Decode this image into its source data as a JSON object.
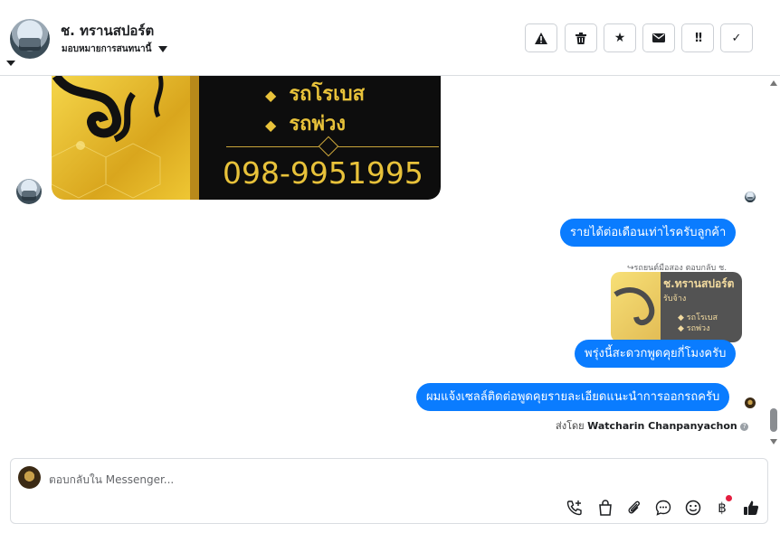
{
  "header": {
    "page_name": "ช. ทรานสปอร์ต",
    "assign_label": "มอบหมายการสนทนานี้",
    "toolbar": [
      {
        "icon": "warning-icon",
        "glyph": "⚠"
      },
      {
        "icon": "trash-icon",
        "glyph": "🗑"
      },
      {
        "icon": "star-icon",
        "glyph": "★"
      },
      {
        "icon": "mail-icon",
        "glyph": "✉"
      },
      {
        "icon": "priority-icon",
        "glyph": "!!"
      },
      {
        "icon": "check-icon",
        "glyph": "✓"
      }
    ]
  },
  "banner": {
    "line1": "รถโรเบส",
    "line2": "รถพ่วง",
    "phone": "098-9951995"
  },
  "messages": {
    "m1": "รายได้ต่อเดือนเท่าไรครับลูกค้า",
    "reply_header": "รถยนต์มือสอง ตอบกลับ ช.",
    "thumb_title": "ช.ทรานสปอร์ต",
    "thumb_sub": "รับจ้าง",
    "thumb_l1": "รถโรเบส",
    "thumb_l2": "รถพ่วง",
    "m2": "พรุ่งนี้สะดวกพูดคุยกี่โมงครับ",
    "m3": "ผมแจ้งเซลล์ติดต่อพูดคุยรายละเอียดแนะนำการออกรถครับ",
    "sent_by_label": "ส่งโดย",
    "sent_by_name": "Watcharin Chanpanyachon"
  },
  "composer": {
    "placeholder": "ตอบกลับใน Messenger...",
    "icons": [
      "call-add-icon",
      "bag-icon",
      "attach-icon",
      "chat-icon",
      "emoji-icon",
      "baht-icon",
      "like-icon"
    ]
  },
  "colors": {
    "accent": "#0a7cff",
    "gold": "#e8c23a",
    "dark": "#0d0d0d"
  }
}
